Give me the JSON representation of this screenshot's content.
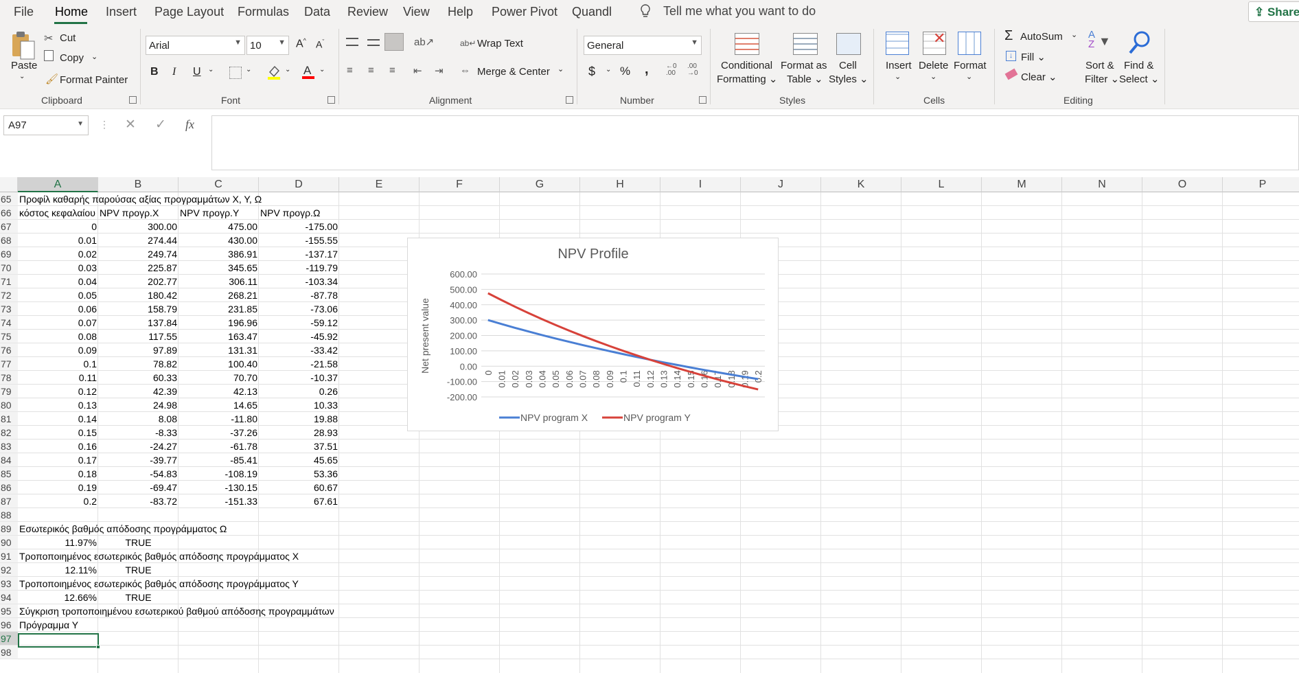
{
  "menu": {
    "tabs": [
      "File",
      "Home",
      "Insert",
      "Page Layout",
      "Formulas",
      "Data",
      "Review",
      "View",
      "Help",
      "Power Pivot",
      "Quandl"
    ],
    "tell_me": "Tell me what you want to do",
    "share": "Share"
  },
  "ribbon": {
    "clipboard": {
      "paste": "Paste",
      "cut": "Cut",
      "copy": "Copy",
      "format_painter": "Format Painter",
      "group": "Clipboard"
    },
    "font": {
      "name": "Arial",
      "size": "10",
      "bold": "B",
      "italic": "I",
      "underline": "U",
      "group": "Font"
    },
    "alignment": {
      "wrap": "Wrap Text",
      "merge": "Merge & Center",
      "group": "Alignment"
    },
    "number": {
      "format": "General",
      "currency": "$",
      "percent": "%",
      "comma": ",",
      "group": "Number"
    },
    "styles": {
      "conditional": [
        "Conditional",
        "Formatting"
      ],
      "format_table": [
        "Format as",
        "Table"
      ],
      "cell_styles": [
        "Cell",
        "Styles"
      ],
      "group": "Styles"
    },
    "cells": {
      "insert": "Insert",
      "delete": "Delete",
      "format": "Format",
      "group": "Cells"
    },
    "editing": {
      "autosum": "AutoSum",
      "fill": "Fill",
      "clear": "Clear",
      "sort": [
        "Sort &",
        "Filter"
      ],
      "find": [
        "Find &",
        "Select"
      ],
      "group": "Editing"
    },
    "colors": {
      "fill_color": "#ffff00",
      "font_color": "#ff0000",
      "accent": "#217346"
    }
  },
  "formula_bar": {
    "name_box": "A97",
    "content": ""
  },
  "columns": [
    "A",
    "B",
    "C",
    "D",
    "E",
    "F",
    "G",
    "H",
    "I",
    "J",
    "K",
    "L",
    "M",
    "N",
    "O",
    "P"
  ],
  "rows": [
    {
      "n": "65",
      "a": "Προφίλ καθαρής παρούσας αξίας προγραμμάτων Χ, Υ, Ω",
      "b": "",
      "c": "",
      "d": ""
    },
    {
      "n": "66",
      "a": "κόστος κεφαλαίου",
      "b": "NPV προγρ.Χ",
      "c": "NPV προγρ.Υ",
      "d": "NPV προγρ.Ω"
    },
    {
      "n": "67",
      "a": "0",
      "b": "300.00",
      "c": "475.00",
      "d": "-175.00"
    },
    {
      "n": "68",
      "a": "0.01",
      "b": "274.44",
      "c": "430.00",
      "d": "-155.55"
    },
    {
      "n": "69",
      "a": "0.02",
      "b": "249.74",
      "c": "386.91",
      "d": "-137.17"
    },
    {
      "n": "70",
      "a": "0.03",
      "b": "225.87",
      "c": "345.65",
      "d": "-119.79"
    },
    {
      "n": "71",
      "a": "0.04",
      "b": "202.77",
      "c": "306.11",
      "d": "-103.34"
    },
    {
      "n": "72",
      "a": "0.05",
      "b": "180.42",
      "c": "268.21",
      "d": "-87.78"
    },
    {
      "n": "73",
      "a": "0.06",
      "b": "158.79",
      "c": "231.85",
      "d": "-73.06"
    },
    {
      "n": "74",
      "a": "0.07",
      "b": "137.84",
      "c": "196.96",
      "d": "-59.12"
    },
    {
      "n": "75",
      "a": "0.08",
      "b": "117.55",
      "c": "163.47",
      "d": "-45.92"
    },
    {
      "n": "76",
      "a": "0.09",
      "b": "97.89",
      "c": "131.31",
      "d": "-33.42"
    },
    {
      "n": "77",
      "a": "0.1",
      "b": "78.82",
      "c": "100.40",
      "d": "-21.58"
    },
    {
      "n": "78",
      "a": "0.11",
      "b": "60.33",
      "c": "70.70",
      "d": "-10.37"
    },
    {
      "n": "79",
      "a": "0.12",
      "b": "42.39",
      "c": "42.13",
      "d": "0.26"
    },
    {
      "n": "80",
      "a": "0.13",
      "b": "24.98",
      "c": "14.65",
      "d": "10.33"
    },
    {
      "n": "81",
      "a": "0.14",
      "b": "8.08",
      "c": "-11.80",
      "d": "19.88"
    },
    {
      "n": "82",
      "a": "0.15",
      "b": "-8.33",
      "c": "-37.26",
      "d": "28.93"
    },
    {
      "n": "83",
      "a": "0.16",
      "b": "-24.27",
      "c": "-61.78",
      "d": "37.51"
    },
    {
      "n": "84",
      "a": "0.17",
      "b": "-39.77",
      "c": "-85.41",
      "d": "45.65"
    },
    {
      "n": "85",
      "a": "0.18",
      "b": "-54.83",
      "c": "-108.19",
      "d": "53.36"
    },
    {
      "n": "86",
      "a": "0.19",
      "b": "-69.47",
      "c": "-130.15",
      "d": "60.67"
    },
    {
      "n": "87",
      "a": "0.2",
      "b": "-83.72",
      "c": "-151.33",
      "d": "67.61"
    },
    {
      "n": "88",
      "a": "",
      "b": "",
      "c": "",
      "d": ""
    },
    {
      "n": "89",
      "a": "Εσωτερικός βαθμός απόδοσης προγράμματος Ω",
      "b": "",
      "c": "",
      "d": ""
    },
    {
      "n": "90",
      "a": "11.97%",
      "b": "TRUE",
      "c": "",
      "d": ""
    },
    {
      "n": "91",
      "a": "Τροποποιημένος εσωτερικός βαθμός απόδοσης προγράμματος Χ",
      "b": "",
      "c": "",
      "d": ""
    },
    {
      "n": "92",
      "a": "12.11%",
      "b": "TRUE",
      "c": "",
      "d": ""
    },
    {
      "n": "93",
      "a": "Τροποποιημένος εσωτερικός βαθμός απόδοσης προγράμματος Υ",
      "b": "",
      "c": "",
      "d": ""
    },
    {
      "n": "94",
      "a": "12.66%",
      "b": "TRUE",
      "c": "",
      "d": ""
    },
    {
      "n": "95",
      "a": "Σύγκριση τροποποιημένου εσωτερικού βαθμού απόδοσης προγραμμάτων",
      "b": "",
      "c": "",
      "d": ""
    },
    {
      "n": "96",
      "a": "Πρόγραμμα Υ",
      "b": "",
      "c": "",
      "d": ""
    },
    {
      "n": "97",
      "a": "",
      "b": "",
      "c": "",
      "d": ""
    },
    {
      "n": "98",
      "a": "",
      "b": "",
      "c": "",
      "d": ""
    }
  ],
  "chart_data": {
    "type": "line",
    "title": "NPV Profile",
    "xlabel": "",
    "ylabel": "Net present value",
    "categories": [
      "0",
      "0.01",
      "0.02",
      "0.03",
      "0.04",
      "0.05",
      "0.06",
      "0.07",
      "0.08",
      "0.09",
      "0.1",
      "0.11",
      "0.12",
      "0.13",
      "0.14",
      "0.15",
      "0.16",
      "0.17",
      "0.18",
      "0.19",
      "0.2"
    ],
    "yticks": [
      "600.00",
      "500.00",
      "400.00",
      "300.00",
      "200.00",
      "100.00",
      "0.00",
      "-100.00",
      "-200.00"
    ],
    "ylim": [
      -200,
      600
    ],
    "grid": true,
    "legend": "bottom",
    "series": [
      {
        "name": "NPV program X",
        "color": "#4a7fd4",
        "values": [
          300.0,
          274.44,
          249.74,
          225.87,
          202.77,
          180.42,
          158.79,
          137.84,
          117.55,
          97.89,
          78.82,
          60.33,
          42.39,
          24.98,
          8.08,
          -8.33,
          -24.27,
          -39.77,
          -54.83,
          -69.47,
          -83.72
        ]
      },
      {
        "name": "NPV program Y",
        "color": "#d7423a",
        "values": [
          475.0,
          430.0,
          386.91,
          345.65,
          306.11,
          268.21,
          231.85,
          196.96,
          163.47,
          131.31,
          100.4,
          70.7,
          42.13,
          14.65,
          -11.8,
          -37.26,
          -61.78,
          -85.41,
          -108.19,
          -130.15,
          -151.33
        ]
      }
    ]
  }
}
